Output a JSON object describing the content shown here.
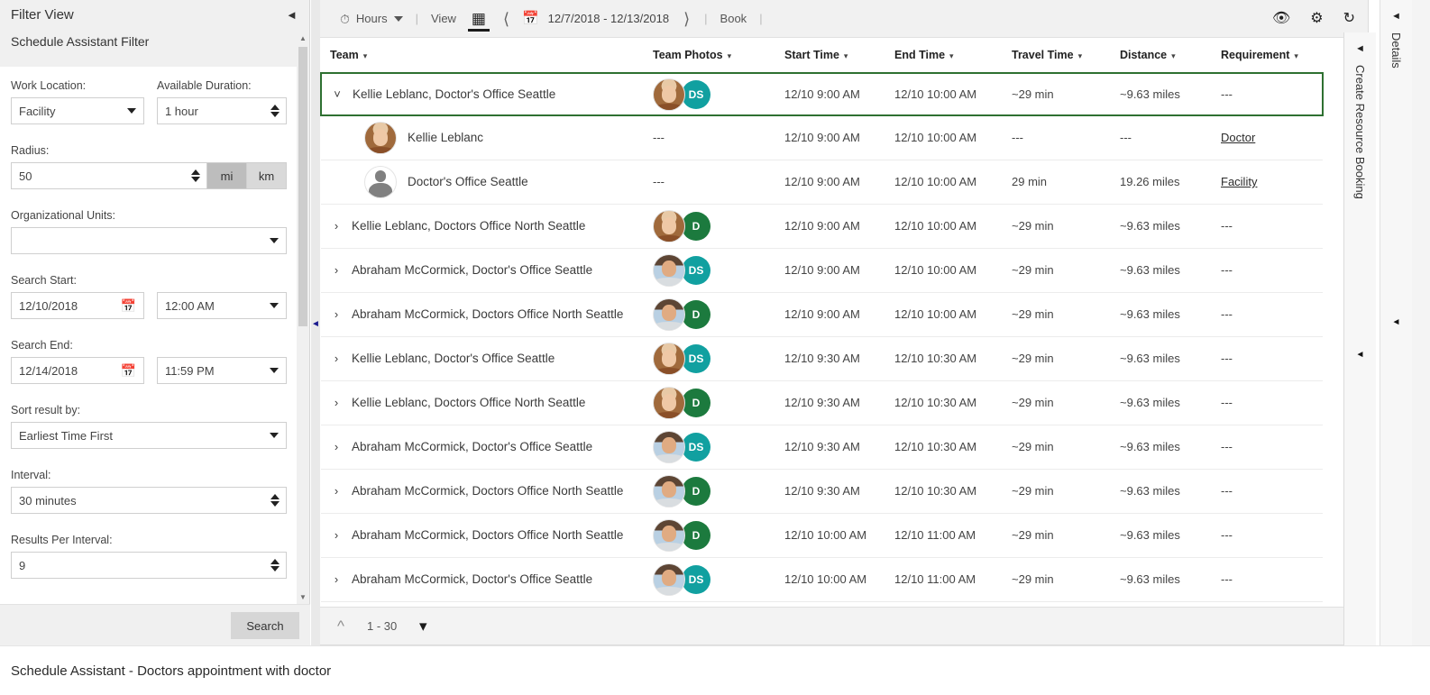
{
  "filter_panel": {
    "title": "Filter View",
    "subtitle": "Schedule Assistant Filter",
    "collapse_icon": "collapse-left-icon",
    "fields": {
      "work_location_label": "Work Location:",
      "work_location_value": "Facility",
      "available_duration_label": "Available Duration:",
      "available_duration_value": "1 hour",
      "radius_label": "Radius:",
      "radius_value": "50",
      "unit_mi": "mi",
      "unit_km": "km",
      "unit_selected": "mi",
      "org_units_label": "Organizational Units:",
      "org_units_value": "",
      "search_start_label": "Search Start:",
      "search_start_date": "12/10/2018",
      "search_start_time": "12:00 AM",
      "search_end_label": "Search End:",
      "search_end_date": "12/14/2018",
      "search_end_time": "11:59 PM",
      "sort_label": "Sort result by:",
      "sort_value": "Earliest Time First",
      "interval_label": "Interval:",
      "interval_value": "30 minutes",
      "results_per_interval_label": "Results Per Interval:",
      "results_per_interval_value": "9"
    },
    "search_button": "Search"
  },
  "toolbar": {
    "hours_label": "Hours",
    "view_label": "View",
    "date_range": "12/7/2018 - 12/13/2018",
    "book_label": "Book",
    "separator": "|",
    "prev_icon": "chevron-left-icon",
    "next_icon": "chevron-right-icon",
    "clock_icon": "clock-icon",
    "grid_icon": "grid-view-icon",
    "calendar_icon": "calendar-icon",
    "eye_icon": "eye-icon",
    "gear_icon": "gear-icon",
    "refresh_icon": "refresh-icon"
  },
  "grid": {
    "columns": [
      {
        "key": "team",
        "label": "Team"
      },
      {
        "key": "photos",
        "label": "Team Photos"
      },
      {
        "key": "start",
        "label": "Start Time"
      },
      {
        "key": "end",
        "label": "End Time"
      },
      {
        "key": "travel",
        "label": "Travel Time"
      },
      {
        "key": "distance",
        "label": "Distance"
      },
      {
        "key": "requirement",
        "label": "Requirement"
      }
    ],
    "rows": [
      {
        "team": "Kellie Leblanc, Doctor's Office Seattle",
        "expanded": true,
        "selected": true,
        "avatar": "kellie",
        "badge": "DS",
        "badge_color": "#11a0a0",
        "start": "12/10 9:00 AM",
        "end": "12/10 10:00 AM",
        "travel": "~29 min",
        "distance": "~9.63 miles",
        "requirement": "---",
        "children": [
          {
            "name": "Kellie Leblanc",
            "avatar": "kellie",
            "photos": "---",
            "start": "12/10 9:00 AM",
            "end": "12/10 10:00 AM",
            "travel": "---",
            "distance": "---",
            "requirement": "Doctor"
          },
          {
            "name": "Doctor's Office Seattle",
            "avatar": "generic",
            "photos": "---",
            "start": "12/10 9:00 AM",
            "end": "12/10 10:00 AM",
            "travel": "29 min",
            "distance": "19.26 miles",
            "requirement": "Facility"
          }
        ]
      },
      {
        "team": "Kellie Leblanc, Doctors Office North Seattle",
        "expanded": false,
        "selected": false,
        "avatar": "kellie",
        "badge": "D",
        "badge_color": "#1c7a3e",
        "start": "12/10 9:00 AM",
        "end": "12/10 10:00 AM",
        "travel": "~29 min",
        "distance": "~9.63 miles",
        "requirement": "---"
      },
      {
        "team": "Abraham McCormick, Doctor's Office Seattle",
        "expanded": false,
        "selected": false,
        "avatar": "abe",
        "badge": "DS",
        "badge_color": "#11a0a0",
        "start": "12/10 9:00 AM",
        "end": "12/10 10:00 AM",
        "travel": "~29 min",
        "distance": "~9.63 miles",
        "requirement": "---"
      },
      {
        "team": "Abraham McCormick, Doctors Office North Seattle",
        "expanded": false,
        "selected": false,
        "avatar": "abe",
        "badge": "D",
        "badge_color": "#1c7a3e",
        "start": "12/10 9:00 AM",
        "end": "12/10 10:00 AM",
        "travel": "~29 min",
        "distance": "~9.63 miles",
        "requirement": "---"
      },
      {
        "team": "Kellie Leblanc, Doctor's Office Seattle",
        "expanded": false,
        "selected": false,
        "avatar": "kellie",
        "badge": "DS",
        "badge_color": "#11a0a0",
        "start": "12/10 9:30 AM",
        "end": "12/10 10:30 AM",
        "travel": "~29 min",
        "distance": "~9.63 miles",
        "requirement": "---"
      },
      {
        "team": "Kellie Leblanc, Doctors Office North Seattle",
        "expanded": false,
        "selected": false,
        "avatar": "kellie",
        "badge": "D",
        "badge_color": "#1c7a3e",
        "start": "12/10 9:30 AM",
        "end": "12/10 10:30 AM",
        "travel": "~29 min",
        "distance": "~9.63 miles",
        "requirement": "---"
      },
      {
        "team": "Abraham McCormick, Doctor's Office Seattle",
        "expanded": false,
        "selected": false,
        "avatar": "abe",
        "badge": "DS",
        "badge_color": "#11a0a0",
        "start": "12/10 9:30 AM",
        "end": "12/10 10:30 AM",
        "travel": "~29 min",
        "distance": "~9.63 miles",
        "requirement": "---"
      },
      {
        "team": "Abraham McCormick, Doctors Office North Seattle",
        "expanded": false,
        "selected": false,
        "avatar": "abe",
        "badge": "D",
        "badge_color": "#1c7a3e",
        "start": "12/10 9:30 AM",
        "end": "12/10 10:30 AM",
        "travel": "~29 min",
        "distance": "~9.63 miles",
        "requirement": "---"
      },
      {
        "team": "Abraham McCormick, Doctors Office North Seattle",
        "expanded": false,
        "selected": false,
        "avatar": "abe",
        "badge": "D",
        "badge_color": "#1c7a3e",
        "start": "12/10 10:00 AM",
        "end": "12/10 11:00 AM",
        "travel": "~29 min",
        "distance": "~9.63 miles",
        "requirement": "---"
      },
      {
        "team": "Abraham McCormick, Doctor's Office Seattle",
        "expanded": false,
        "selected": false,
        "avatar": "abe",
        "badge": "DS",
        "badge_color": "#11a0a0",
        "start": "12/10 10:00 AM",
        "end": "12/10 11:00 AM",
        "travel": "~29 min",
        "distance": "~9.63 miles",
        "requirement": "---"
      }
    ]
  },
  "pager": {
    "up_icon": "chevron-up-icon",
    "down_icon": "chevron-down-icon",
    "range_label": "1 - 30"
  },
  "rails": {
    "create_resource_booking": "Create Resource Booking",
    "details": "Details"
  },
  "statusbar": {
    "text": "Schedule Assistant - Doctors appointment with doctor"
  },
  "colors": {
    "selection_green": "#2e7031",
    "badge_teal": "#11a0a0",
    "badge_green": "#1c7a3e"
  }
}
